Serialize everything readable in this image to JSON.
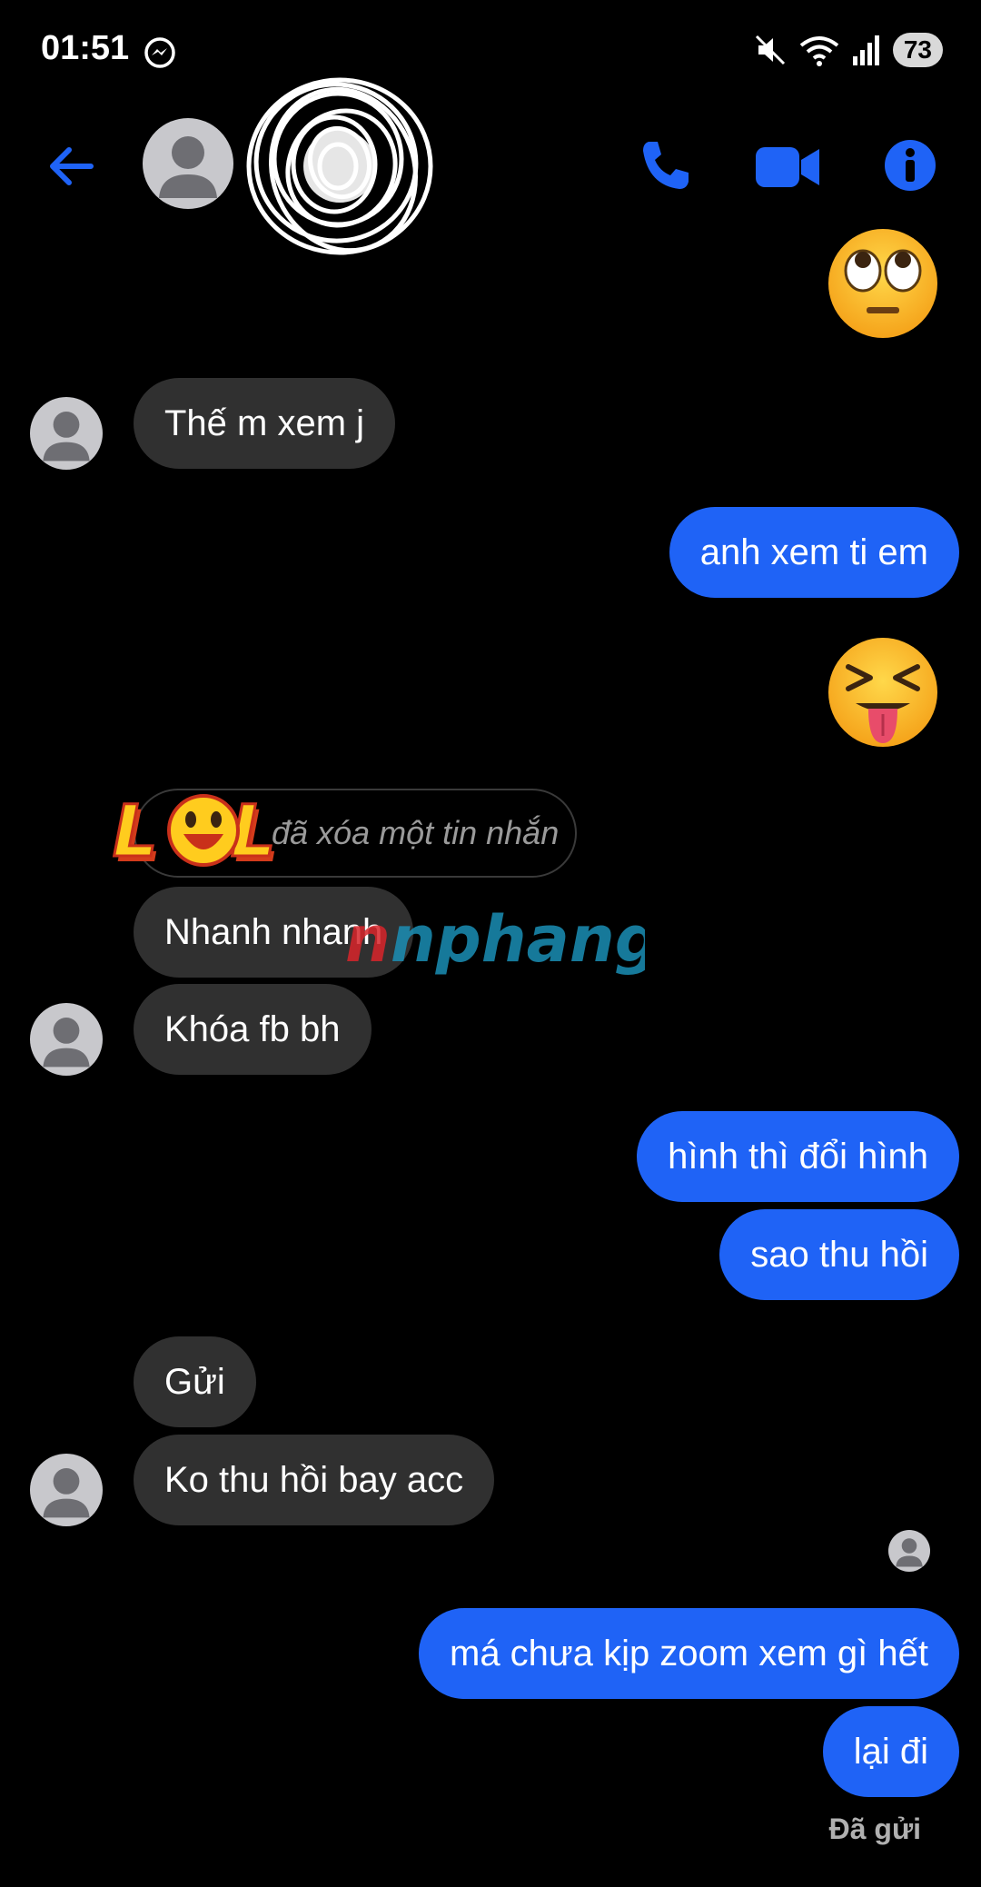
{
  "status_bar": {
    "time": "01:51",
    "battery": "73",
    "icons": [
      "messenger-icon",
      "mute-icon",
      "wifi-icon",
      "signal-icon",
      "battery-icon"
    ]
  },
  "header": {
    "icons": [
      "back-arrow-icon",
      "phone-icon",
      "video-camera-icon",
      "info-icon"
    ],
    "accent_color": "#1f63f6"
  },
  "messages": [
    {
      "from": "them",
      "text": "Thế m xem j"
    },
    {
      "from": "me",
      "text": "anh xem ti em"
    },
    {
      "from": "them",
      "text": "đã xóa một tin nhắn",
      "removed": true
    },
    {
      "from": "them",
      "text": "Nhanh nhanh"
    },
    {
      "from": "them",
      "text": "Khóa fb bh"
    },
    {
      "from": "me",
      "text": "hình thì đổi hình"
    },
    {
      "from": "me",
      "text": "sao thu hồi"
    },
    {
      "from": "them",
      "text": "Gửi"
    },
    {
      "from": "them",
      "text": "Ko thu hồi bay acc"
    },
    {
      "from": "me",
      "text": "má chưa kịp zoom xem gì hết"
    },
    {
      "from": "me",
      "text": "lại đi"
    }
  ],
  "emojis": [
    "face-with-rolling-eyes",
    "squinting-face-with-tongue"
  ],
  "watermark": {
    "text": "nphang",
    "logo": "LOL"
  },
  "sent_status": "Đã gửi",
  "colors": {
    "incoming_bubble": "#303030",
    "outgoing_bubble": "#1f63f6",
    "background": "#000000"
  }
}
